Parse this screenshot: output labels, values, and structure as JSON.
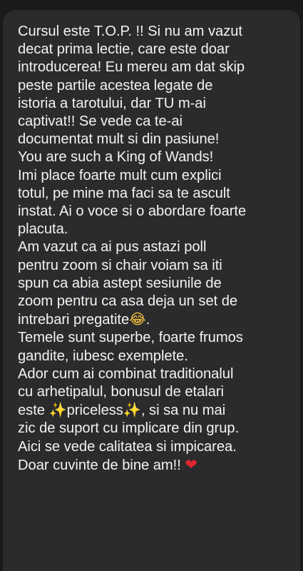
{
  "message": {
    "lines": [
      "Cursul este T.O.P. !! Si nu am vazut",
      "decat prima lectie, care este doar",
      "introducerea! Eu mereu am dat skip",
      "peste partile acestea legate de",
      "istoria a tarotului, dar TU m-ai",
      "captivat!! Se vede ca te-ai",
      "documentat mult si din pasiune!",
      "You are such a King of Wands!",
      "Imi place foarte mult cum explici",
      "totul, pe mine ma faci sa te ascult",
      "instat. Ai o voce si o abordare foarte",
      "placuta.",
      "Am vazut ca ai pus astazi poll",
      "pentru zoom si chair voiam sa iti",
      "spun ca abia astept sesiunile de",
      "zoom pentru ca asa deja un set de",
      "intrebari pregatite",
      "Temele sunt superbe, foarte frumos",
      "gandite, iubesc exemplete.",
      "Ador cum ai combinat traditionalul",
      "cu arhetipalul, bonusul de etalari",
      "este ",
      "priceless",
      ", si sa nu mai",
      "zic de suport cu implicare din grup.",
      "Aici se vede calitatea si impicarea.",
      "Doar cuvinte de bine am!! "
    ],
    "emoji": {
      "laugh": "😂",
      "laugh_suffix": ".",
      "sparkle": "✨",
      "heart": "❤"
    }
  },
  "colors": {
    "background": "#1a1a1d",
    "bubble": "#2b2b2e",
    "text": "#f2f2f2",
    "heart": "#e0242f"
  }
}
